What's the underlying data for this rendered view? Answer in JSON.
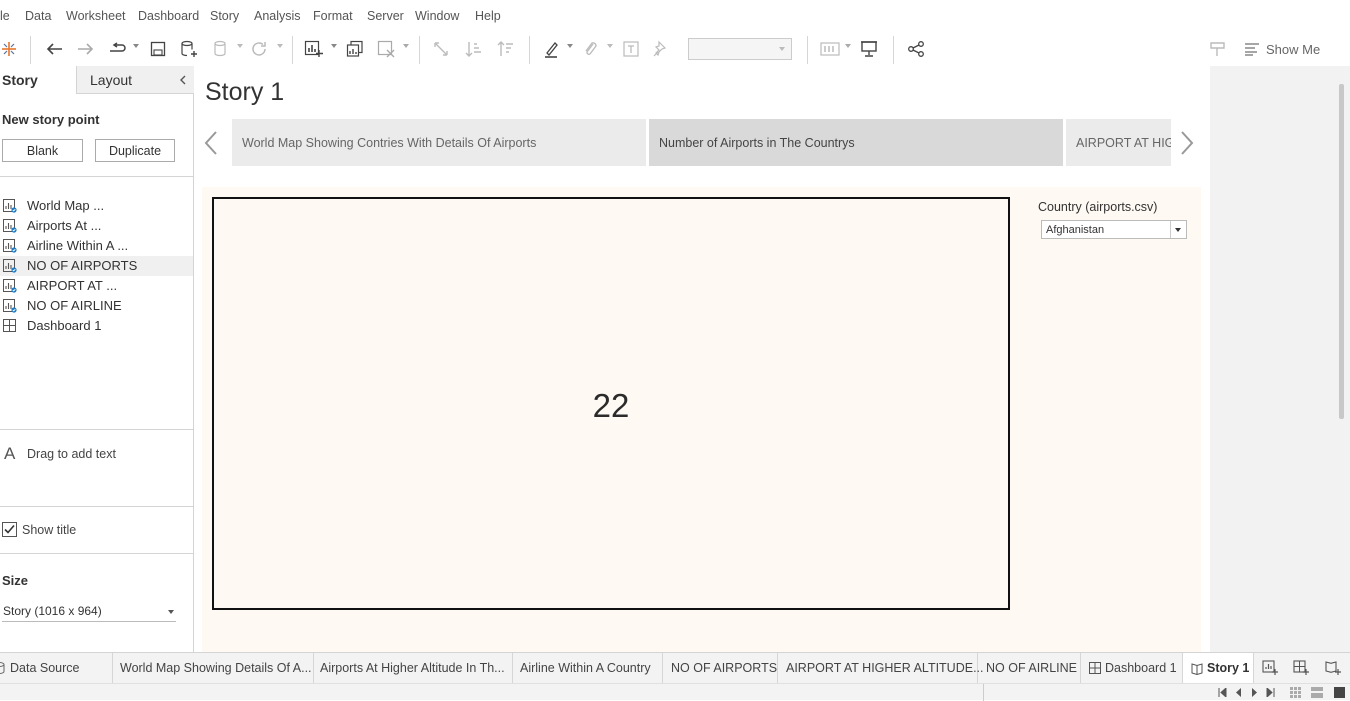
{
  "menu": [
    "le",
    "Data",
    "Worksheet",
    "Dashboard",
    "Story",
    "Analysis",
    "Format",
    "Server",
    "Window",
    "Help"
  ],
  "toolbar": {
    "show_me": "Show Me",
    "accent": "#1e7cc8"
  },
  "left_pane": {
    "tabs": {
      "story": "Story",
      "layout": "Layout"
    },
    "new_story_point": "New story point",
    "blank": "Blank",
    "duplicate": "Duplicate",
    "sheets": [
      {
        "label": "World Map ...",
        "icon": "worksheet-icon"
      },
      {
        "label": "Airports At ...",
        "icon": "worksheet-icon"
      },
      {
        "label": "Airline Within A ...",
        "icon": "worksheet-icon"
      },
      {
        "label": "NO OF AIRPORTS",
        "icon": "worksheet-icon"
      },
      {
        "label": "AIRPORT AT ...",
        "icon": "worksheet-icon"
      },
      {
        "label": "NO OF AIRLINE",
        "icon": "worksheet-icon"
      },
      {
        "label": "Dashboard 1",
        "icon": "dashboard-icon"
      }
    ],
    "drag_text": "Drag to add text",
    "show_title": "Show title",
    "size_label": "Size",
    "size_value": "Story (1016 x 964)"
  },
  "story": {
    "title": "Story 1",
    "points": [
      "World Map Showing Contries With Details Of Airports",
      "Number of Airports in The Countrys",
      "AIRPORT AT HIGHER ALTITUDE"
    ],
    "kpi_value": "22",
    "filter_label": "Country (airports.csv)",
    "filter_value": "Afghanistan"
  },
  "bottom_tabs": [
    "Data Source",
    "World Map Showing Details Of A...",
    "Airports At Higher Altitude In Th...",
    "Airline Within A Country",
    "NO OF AIRPORTS",
    "AIRPORT AT HIGHER ALTITUDE...",
    "NO OF AIRLINE",
    "Dashboard 1",
    "Story 1"
  ]
}
